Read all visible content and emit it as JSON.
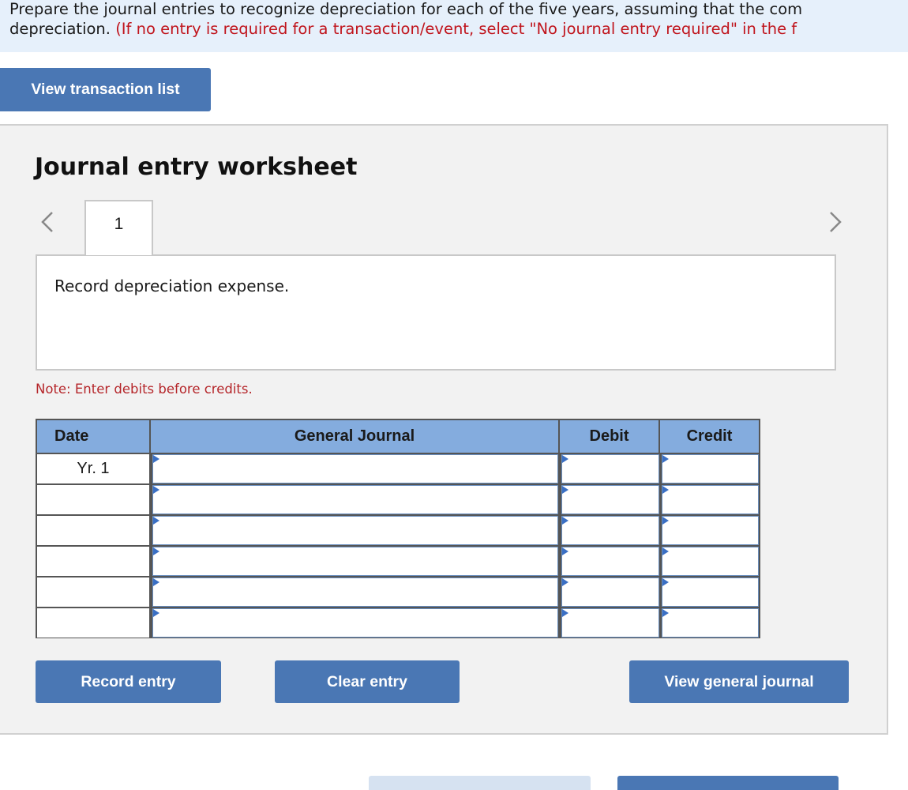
{
  "instructions": {
    "line1": "Prepare the journal entries to recognize depreciation for each of the five years, assuming that the com",
    "line2_black": "depreciation. ",
    "line2_red": "(If no entry is required for a transaction/event, select \"No journal entry required\" in the f"
  },
  "buttons": {
    "view_transaction_list": "View transaction list",
    "record_entry": "Record entry",
    "clear_entry": "Clear entry",
    "view_general_journal": "View general journal"
  },
  "worksheet": {
    "title": "Journal entry worksheet",
    "tabs": [
      {
        "label": "1"
      }
    ],
    "description": "Record depreciation expense.",
    "note": "Note: Enter debits before credits."
  },
  "table": {
    "headers": {
      "date": "Date",
      "journal": "General Journal",
      "debit": "Debit",
      "credit": "Credit"
    },
    "rows": [
      {
        "date": "Yr. 1",
        "journal": "",
        "debit": "",
        "credit": ""
      },
      {
        "date": "",
        "journal": "",
        "debit": "",
        "credit": ""
      },
      {
        "date": "",
        "journal": "",
        "debit": "",
        "credit": ""
      },
      {
        "date": "",
        "journal": "",
        "debit": "",
        "credit": ""
      },
      {
        "date": "",
        "journal": "",
        "debit": "",
        "credit": ""
      },
      {
        "date": "",
        "journal": "",
        "debit": "",
        "credit": ""
      }
    ]
  },
  "colors": {
    "banner_bg": "#e6f0fb",
    "button_blue": "#4a77b4",
    "header_blue": "#84acde",
    "note_red": "#b5262a",
    "instruction_red": "#c0141c"
  },
  "icons": {
    "prev": "chevron-left-icon",
    "next": "chevron-right-icon",
    "cell_marker": "triangle-marker-icon"
  }
}
